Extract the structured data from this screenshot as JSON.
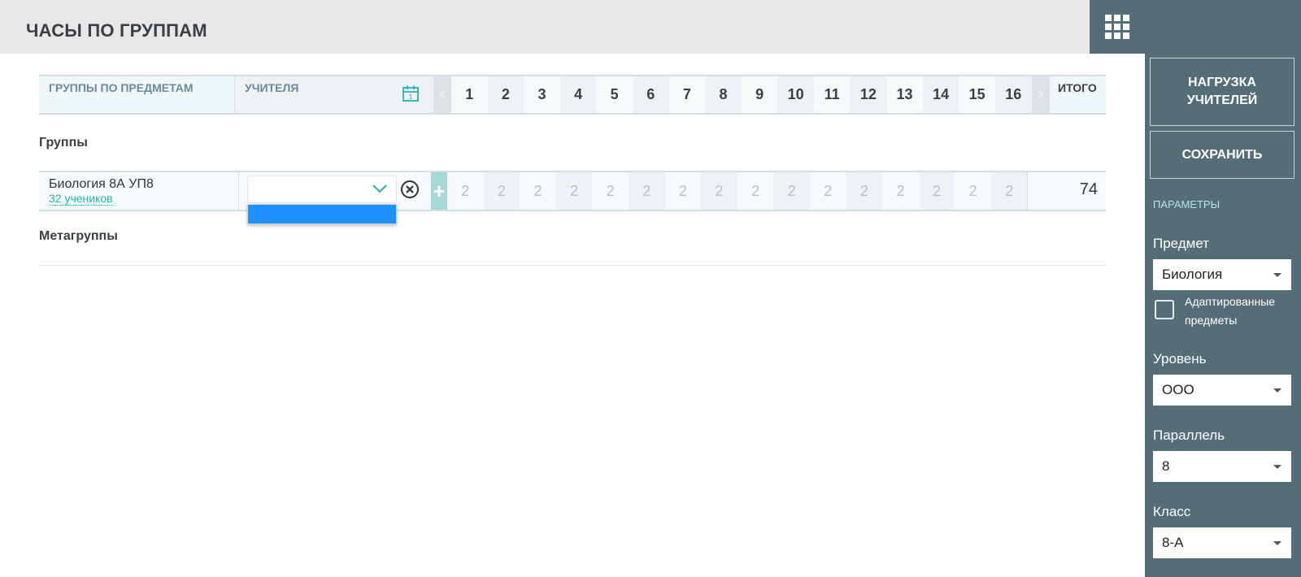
{
  "header": {
    "title": "ЧАСЫ ПО ГРУППАМ"
  },
  "sidebar": {
    "load_button": "НАГРУЗКА УЧИТЕЛЕЙ",
    "save_button": "СОХРАНИТЬ",
    "params_title": "ПАРАМЕТРЫ",
    "subject_label": "Предмет",
    "subject_value": "Биология",
    "adapted_label": "Адаптированные предметы",
    "level_label": "Уровень",
    "level_value": "ООО",
    "parallel_label": "Параллель",
    "parallel_value": "8",
    "class_label": "Класс",
    "class_value": "8-А"
  },
  "table": {
    "col_groups": "ГРУППЫ ПО ПРЕДМЕТАМ",
    "col_teachers": "УЧИТЕЛЯ",
    "weeks": [
      "1",
      "2",
      "3",
      "4",
      "5",
      "6",
      "7",
      "8",
      "9",
      "10",
      "11",
      "12",
      "13",
      "14",
      "15",
      "16"
    ],
    "col_total": "ИТОГО",
    "prev_arrow": "‹",
    "next_arrow": "›",
    "plus": "+"
  },
  "groups_section": {
    "title": "Группы"
  },
  "metagroups_section": {
    "title": "Метагруппы"
  },
  "rows": [
    {
      "name": "Биология 8А УП8",
      "students": "32 учеников",
      "teacher": "",
      "hours": [
        "2",
        "2",
        "2",
        "2",
        "2",
        "2",
        "2",
        "2",
        "2",
        "2",
        "2",
        "2",
        "2",
        "2",
        "2",
        "2"
      ],
      "total": "74"
    }
  ],
  "colors": {
    "sidebar": "#546d77",
    "accent": "#2ab0b0",
    "selected": "#1e90ff"
  }
}
